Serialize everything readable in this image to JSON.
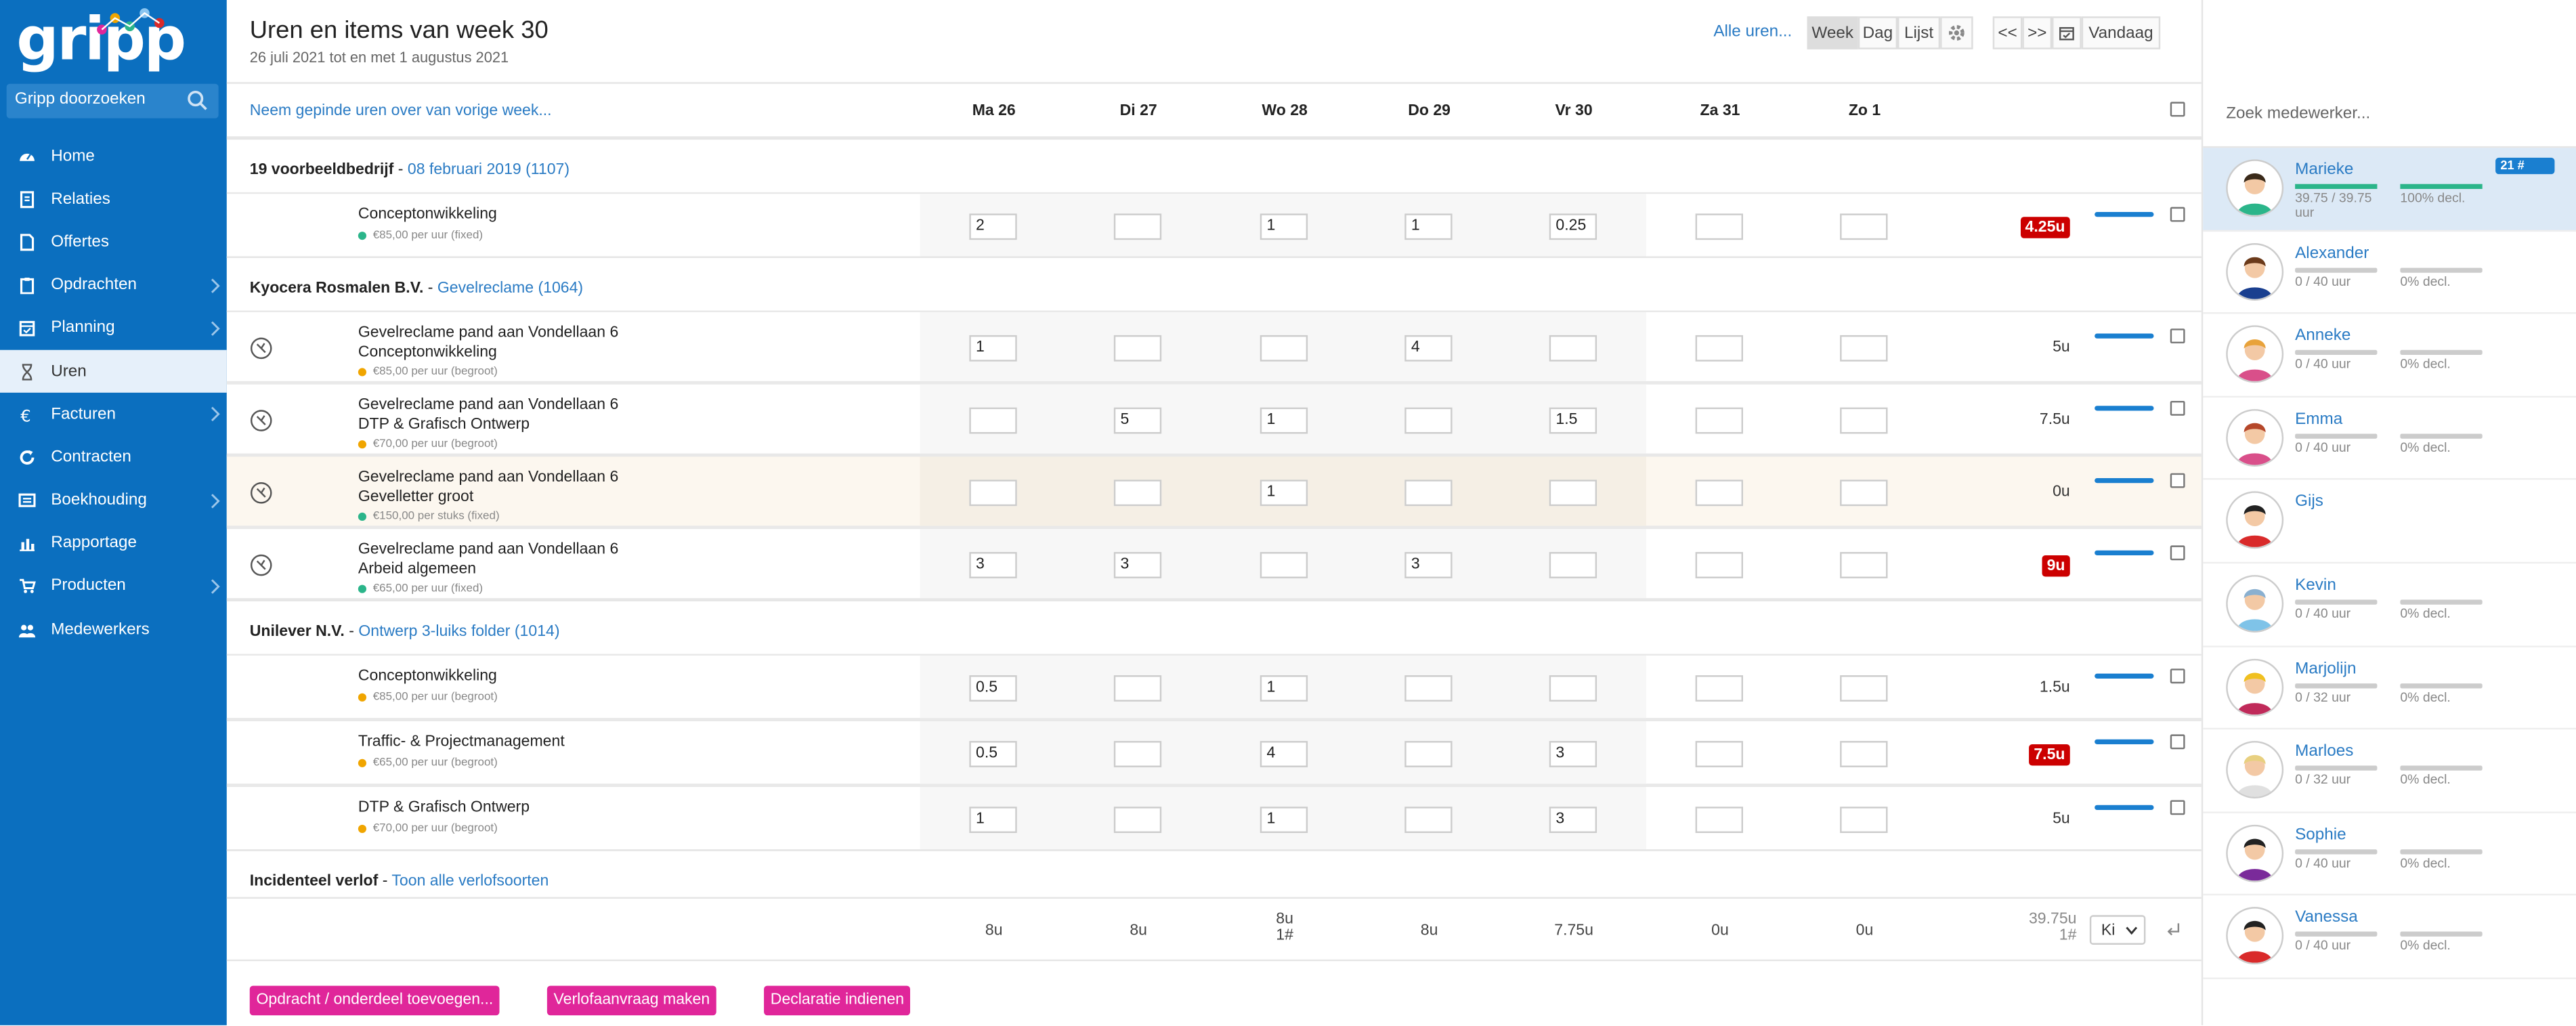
{
  "app": {
    "logo": "gripp",
    "search_placeholder": "Gripp doorzoeken"
  },
  "nav": [
    {
      "label": "Home",
      "icon": "dashboard-icon",
      "chev": false
    },
    {
      "label": "Relaties",
      "icon": "contacts-icon",
      "chev": false
    },
    {
      "label": "Offertes",
      "icon": "document-icon",
      "chev": false
    },
    {
      "label": "Opdrachten",
      "icon": "clipboard-icon",
      "chev": true
    },
    {
      "label": "Planning",
      "icon": "calendar-icon",
      "chev": true
    },
    {
      "label": "Uren",
      "icon": "hourglass-icon",
      "chev": false,
      "active": true
    },
    {
      "label": "Facturen",
      "icon": "euro-icon",
      "chev": true
    },
    {
      "label": "Contracten",
      "icon": "refresh-icon",
      "chev": false
    },
    {
      "label": "Boekhouding",
      "icon": "ledger-icon",
      "chev": true
    },
    {
      "label": "Rapportage",
      "icon": "bar-chart-icon",
      "chev": false
    },
    {
      "label": "Producten",
      "icon": "cart-icon",
      "chev": true
    },
    {
      "label": "Medewerkers",
      "icon": "users-icon",
      "chev": false
    }
  ],
  "header": {
    "title": "Uren en items van week 30",
    "subtitle": "26 juli 2021 tot en met 1 augustus 2021",
    "alle": "Alle uren...",
    "view_week": "Week",
    "view_dag": "Dag",
    "view_lijst": "Lijst",
    "prev": "<<",
    "next": ">>",
    "today": "Vandaag"
  },
  "grid": {
    "neem": "Neem gepinde uren over van vorige week...",
    "days": [
      "Ma 26",
      "Di 27",
      "Wo 28",
      "Do 29",
      "Vr 30",
      "Za 31",
      "Zo 1"
    ]
  },
  "groups": [
    {
      "company": "19 voorbeeldbedrijf",
      "link": "08 februari 2019 (1107)"
    },
    {
      "company": "Kyocera Rosmalen B.V.",
      "link": "Gevelreclame (1064)"
    },
    {
      "company": "Unilever N.V.",
      "link": "Ontwerp 3-luiks folder (1014)"
    },
    {
      "company": "Incidenteel verlof",
      "link": "Toon alle verlofsoorten"
    }
  ],
  "rows": [
    {
      "l1": "Conceptonwikkeling",
      "l2": "",
      "rate": "€85,00 per uur (fixed)",
      "dot": "#2bb58a",
      "timer": false,
      "vals": [
        "2",
        "",
        "1",
        "1",
        "0.25",
        "",
        ""
      ],
      "total": "4.25u",
      "red": true
    },
    {
      "l1": "Gevelreclame pand aan Vondellaan 6",
      "l2": "Conceptonwikkeling",
      "rate": "€85,00 per uur (begroot)",
      "dot": "#f0a500",
      "timer": true,
      "vals": [
        "1",
        "",
        "",
        "4",
        "",
        "",
        ""
      ],
      "total": "5u",
      "red": false
    },
    {
      "l1": "Gevelreclame pand aan Vondellaan 6",
      "l2": "DTP & Grafisch Ontwerp",
      "rate": "€70,00 per uur (begroot)",
      "dot": "#f0a500",
      "timer": true,
      "vals": [
        "",
        "5",
        "1",
        "",
        "1.5",
        "",
        ""
      ],
      "total": "7.5u",
      "red": false
    },
    {
      "l1": "Gevelreclame pand aan Vondellaan 6",
      "l2": "Gevelletter groot",
      "rate": "€150,00 per stuks (fixed)",
      "dot": "#2bb58a",
      "timer": true,
      "vals": [
        "",
        "",
        "1",
        "",
        "",
        "",
        ""
      ],
      "total": "0u",
      "red": false
    },
    {
      "l1": "Gevelreclame pand aan Vondellaan 6",
      "l2": "Arbeid algemeen",
      "rate": "€65,00 per uur (fixed)",
      "dot": "#2bb58a",
      "timer": true,
      "vals": [
        "3",
        "3",
        "",
        "3",
        "",
        "",
        ""
      ],
      "total": "9u",
      "red": true
    },
    {
      "l1": "Conceptonwikkeling",
      "l2": "",
      "rate": "€85,00 per uur (begroot)",
      "dot": "#f0a500",
      "timer": false,
      "vals": [
        "0.5",
        "",
        "1",
        "",
        "",
        "",
        ""
      ],
      "total": "1.5u",
      "red": false
    },
    {
      "l1": "Traffic- & Projectmanagement",
      "l2": "",
      "rate": "€65,00 per uur (begroot)",
      "dot": "#f0a500",
      "timer": false,
      "vals": [
        "0.5",
        "",
        "4",
        "",
        "3",
        "",
        ""
      ],
      "total": "7.5u",
      "red": true
    },
    {
      "l1": "DTP & Grafisch Ontwerp",
      "l2": "",
      "rate": "€70,00 per uur (begroot)",
      "dot": "#f0a500",
      "timer": false,
      "vals": [
        "1",
        "",
        "1",
        "",
        "3",
        "",
        ""
      ],
      "total": "5u",
      "red": false
    }
  ],
  "sums": {
    "days": [
      "8u",
      "8u",
      "8u",
      "8u",
      "7.75u",
      "0u",
      "0u"
    ],
    "wo_extra": "1#",
    "total": "39.75u",
    "total_extra": "1#",
    "select": "Ki"
  },
  "buttons": {
    "opdracht": "Opdracht / onderdeel toevoegen...",
    "verlof": "Verlofaanvraag maken",
    "declaratie": "Declaratie indienen"
  },
  "employees": {
    "search_placeholder": "Zoek medewerker...",
    "list": [
      {
        "name": "Marieke",
        "hours": "39.75 / 39.75 uur",
        "decl": "100% decl.",
        "progress": 1.0,
        "badge": "21 #",
        "sel": true,
        "hair": "#3a2a1a",
        "shirt": "#2bb58a"
      },
      {
        "name": "Alexander",
        "hours": "0 / 40 uur",
        "decl": "0% decl.",
        "progress": 0,
        "hair": "#6b3a1a",
        "shirt": "#1a3f8f"
      },
      {
        "name": "Anneke",
        "hours": "0 / 40 uur",
        "decl": "0% decl.",
        "progress": 0,
        "hair": "#e8a23a",
        "shirt": "#d94f8a"
      },
      {
        "name": "Emma",
        "hours": "0 / 40 uur",
        "decl": "0% decl.",
        "progress": 0,
        "hair": "#b5472a",
        "shirt": "#d94f8a"
      },
      {
        "name": "Gijs",
        "hours": "",
        "decl": "",
        "progress": 0,
        "hair": "#222222",
        "shirt": "#d92a2a"
      },
      {
        "name": "Kevin",
        "hours": "0 / 40 uur",
        "decl": "0% decl.",
        "progress": 0,
        "hair": "#8ab0d0",
        "shirt": "#7fc3e8"
      },
      {
        "name": "Marjolijn",
        "hours": "0 / 32 uur",
        "decl": "0% decl.",
        "progress": 0,
        "hair": "#f0c020",
        "shirt": "#c02a5a"
      },
      {
        "name": "Marloes",
        "hours": "0 / 32 uur",
        "decl": "0% decl.",
        "progress": 0,
        "hair": "#e8d080",
        "shirt": "#e0e0e0"
      },
      {
        "name": "Sophie",
        "hours": "0 / 40 uur",
        "decl": "0% decl.",
        "progress": 0,
        "hair": "#222222",
        "shirt": "#7a2a9a"
      },
      {
        "name": "Vanessa",
        "hours": "0 / 40 uur",
        "decl": "0% decl.",
        "progress": 0,
        "hair": "#222222",
        "shirt": "#d92a2a"
      }
    ]
  }
}
